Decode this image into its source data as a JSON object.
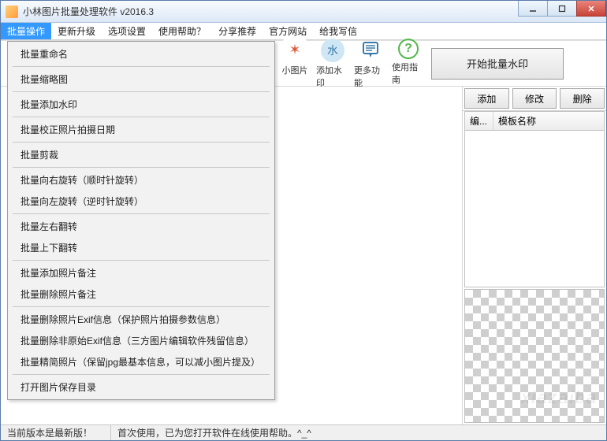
{
  "window": {
    "title": "小林图片批量处理软件 v2016.3"
  },
  "menu": {
    "items": [
      "批量操作",
      "更新升级",
      "选项设置",
      "使用帮助？",
      "分享推荐",
      "官方网站",
      "给我写信"
    ],
    "active_index": 0
  },
  "dropdown": {
    "groups": [
      [
        "批量重命名"
      ],
      [
        "批量缩略图"
      ],
      [
        "批量添加水印"
      ],
      [
        "批量校正照片拍摄日期"
      ],
      [
        "批量剪裁"
      ],
      [
        "批量向右旋转（顺时针旋转）",
        "批量向左旋转（逆时针旋转）"
      ],
      [
        "批量左右翻转",
        "批量上下翻转"
      ],
      [
        "批量添加照片备注",
        "批量删除照片备注"
      ],
      [
        "批量删除照片Exif信息（保护照片拍摄参数信息）",
        "批量删除非原始Exif信息（三方图片编辑软件残留信息）",
        "批量精简照片（保留jpg最基本信息，可以减小图片提及）"
      ],
      [
        "打开图片保存目录"
      ]
    ]
  },
  "toolbar": {
    "shrink": "小图片",
    "water": "添加水印",
    "more": "更多功能",
    "help": "使用指南",
    "big_button": "开始批量水印"
  },
  "side": {
    "add": "添加",
    "edit": "修改",
    "del": "删除",
    "col1": "编...",
    "col2": "模板名称"
  },
  "status": {
    "version": "当前版本是最新版！",
    "message": "首次使用，已为您打开软件在线使用帮助。^_^"
  }
}
